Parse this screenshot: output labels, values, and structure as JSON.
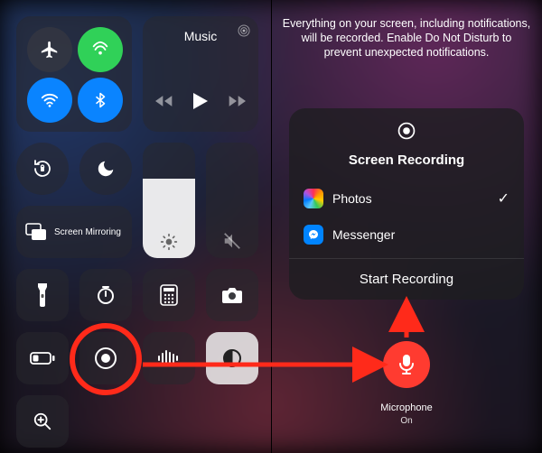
{
  "instructions_banner": "Everything on your screen, including notifications, will be recorded. Enable Do Not Disturb to prevent unexpected notifications.",
  "media": {
    "title": "Music"
  },
  "screen_mirroring": {
    "label": "Screen Mirroring"
  },
  "screen_recording": {
    "title": "Screen Recording",
    "start_label": "Start Recording",
    "apps": [
      {
        "name": "Photos",
        "selected": true
      },
      {
        "name": "Messenger",
        "selected": false
      }
    ]
  },
  "microphone": {
    "label": "Microphone",
    "state": "On"
  },
  "annotation": {
    "highlight_color": "#ff2a1a"
  }
}
